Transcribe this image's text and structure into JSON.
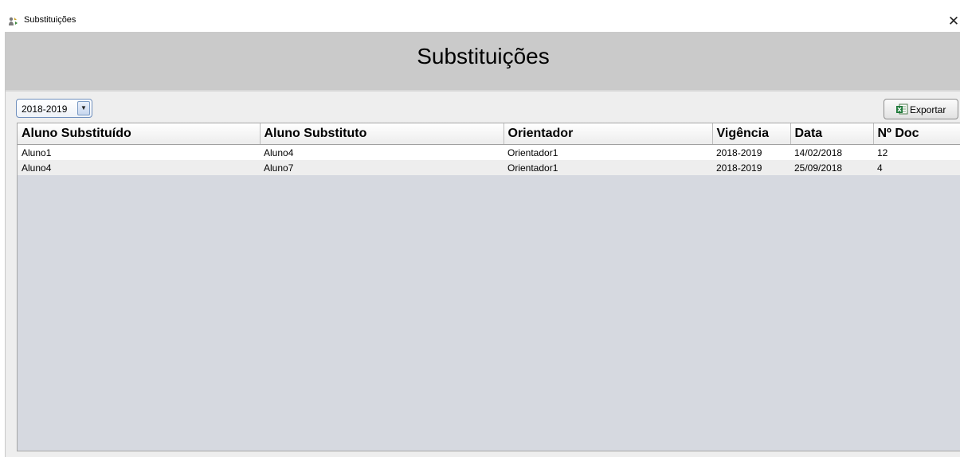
{
  "window": {
    "title": "Substituições",
    "close_glyph": "✕"
  },
  "header": {
    "title": "Substituições"
  },
  "toolbar": {
    "year_filter": "2018-2019",
    "dropdown_arrow": "▼",
    "export_label": "Exportar",
    "export_icon": "excel-icon"
  },
  "table": {
    "columns": [
      "Aluno Substituído",
      "Aluno Substituto",
      "Orientador",
      "Vigência",
      "Data",
      "Nº Doc"
    ],
    "rows": [
      [
        "Aluno1",
        "Aluno4",
        "Orientador1",
        "2018-2019",
        "14/02/2018",
        "12"
      ],
      [
        "Aluno4",
        "Aluno7",
        "Orientador1",
        "2018-2019",
        "25/09/2018",
        "4"
      ]
    ]
  },
  "colors": {
    "banner": "#cacaca",
    "table_background": "#d6d9e0",
    "selector_border": "#6f8fbd",
    "excel_green": "#1f7a3a"
  }
}
